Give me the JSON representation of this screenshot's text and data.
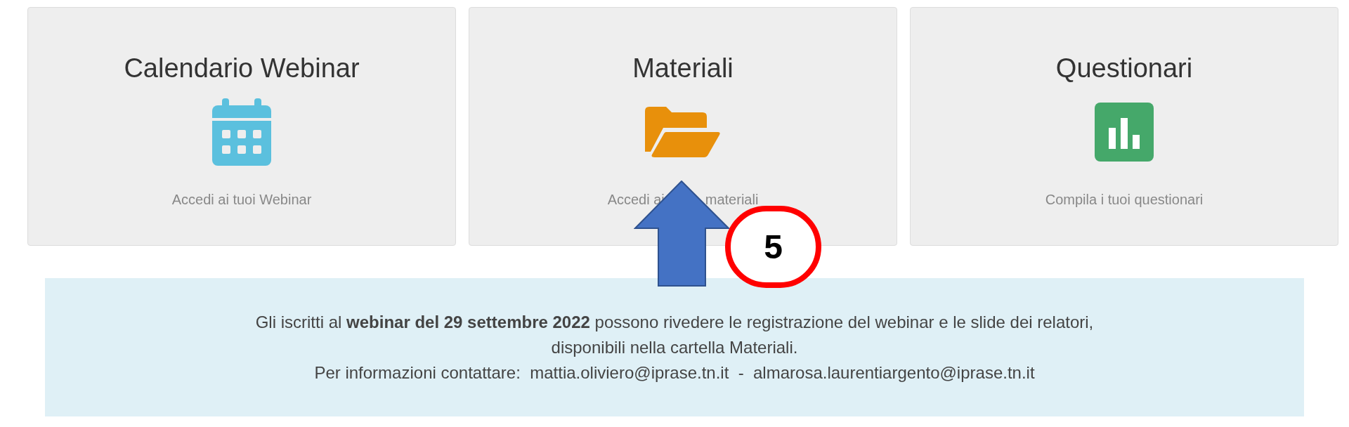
{
  "cards": [
    {
      "title": "Calendario Webinar",
      "subtitle_parts": [
        "Accedi ai tuoi Webinar"
      ]
    },
    {
      "title": "Materiali",
      "subtitle_parts": [
        "Accedi ai",
        "materiali"
      ]
    },
    {
      "title": "Questionari",
      "subtitle_parts": [
        "Compila i tuoi questionari"
      ]
    }
  ],
  "annotation": {
    "number": "5"
  },
  "notice": {
    "lines": [
      "Gli iscritti al **webinar del 29 settembre 2022** possono rivedere le registrazione del webinar e le slide dei relatori,",
      "disponibili nella cartella Materiali.",
      "Per informazioni contattare:  mattia.oliviero@iprase.tn.it  -  almarosa.laurentiargento@iprase.tn.it"
    ]
  }
}
